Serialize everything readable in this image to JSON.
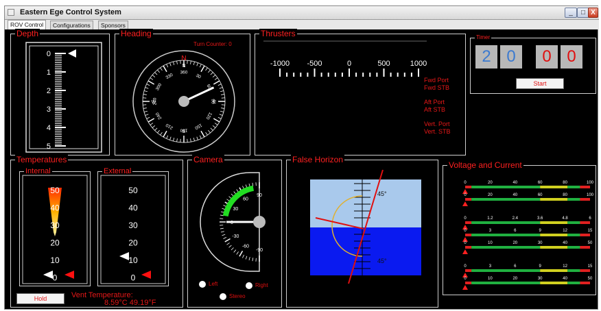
{
  "window": {
    "title": "Eastern Ege Control System",
    "minimize": "_",
    "maximize": "□",
    "close": "X"
  },
  "tabs": [
    {
      "label": "ROV Control"
    },
    {
      "label": "Configurations"
    },
    {
      "label": "Sponsors"
    }
  ],
  "depth": {
    "title": "Depth",
    "ticks": [
      "0",
      "1",
      "2",
      "3",
      "4",
      "5"
    ],
    "value": 0
  },
  "heading": {
    "title": "Heading",
    "turn_counter": "Turn Counter: 0",
    "north_marker": "N",
    "cardinals": {
      "n": "N",
      "e": "E",
      "s": "S",
      "w": "W"
    },
    "degree_labels": [
      "360",
      "30",
      "60",
      "90",
      "120",
      "150",
      "180",
      "210",
      "240",
      "270",
      "300",
      "330"
    ],
    "value_deg": 65
  },
  "thrusters": {
    "title": "Thrusters",
    "scale_labels": [
      "-1000",
      "-500",
      "0",
      "500",
      "1000"
    ],
    "labels": [
      "Fwd Port",
      "Fwd STB",
      "Aft Port",
      "Aft STB",
      "Vert. Port",
      "Vert. STB"
    ]
  },
  "timer": {
    "title": "Timer",
    "digits": [
      "2",
      "0",
      "0",
      "0"
    ],
    "start_label": "Start",
    "colors": [
      "#3b7ad0",
      "#3b7ad0",
      "#e01010",
      "#e01010"
    ]
  },
  "temperatures": {
    "title": "Temperatures",
    "internal": {
      "title": "Internal",
      "ticks": [
        "50",
        "40",
        "30",
        "20",
        "10",
        "0"
      ],
      "level": 0.55
    },
    "external": {
      "title": "External",
      "ticks": [
        "50",
        "40",
        "30",
        "20",
        "10",
        "0"
      ]
    },
    "hold_label": "Hold",
    "vent_label": "Vent Temperature:",
    "vent_value": "8.59°C 49.19°F"
  },
  "camera": {
    "title": "Camera",
    "dial_labels": [
      "90",
      "60",
      "30",
      "0",
      "-30",
      "-60",
      "-90"
    ],
    "radios": [
      "Left",
      "Right",
      "Stereo"
    ]
  },
  "false_horizon": {
    "title": "False Horizon",
    "angle_top": "45°",
    "angle_bottom": "45°",
    "sky_color": "#a9c9ec",
    "water_color": "#0a1af0"
  },
  "voltage_current": {
    "title": "Voltage and Current",
    "gauges": [
      {
        "ticks": [
          "0",
          "20",
          "40",
          "60",
          "80",
          "100"
        ]
      },
      {
        "ticks": [
          "0",
          "20",
          "40",
          "60",
          "80",
          "100"
        ]
      },
      {
        "ticks": [
          "0",
          "1.2",
          "2.4",
          "3.6",
          "4.8",
          "6"
        ]
      },
      {
        "ticks": [
          "0",
          "3",
          "6",
          "9",
          "12",
          "15"
        ]
      },
      {
        "ticks": [
          "0",
          "10",
          "20",
          "30",
          "40",
          "50"
        ]
      },
      {
        "ticks": [
          "0",
          "3",
          "6",
          "9",
          "12",
          "15"
        ]
      },
      {
        "ticks": [
          "0",
          "10",
          "20",
          "30",
          "40",
          "50"
        ]
      }
    ]
  }
}
